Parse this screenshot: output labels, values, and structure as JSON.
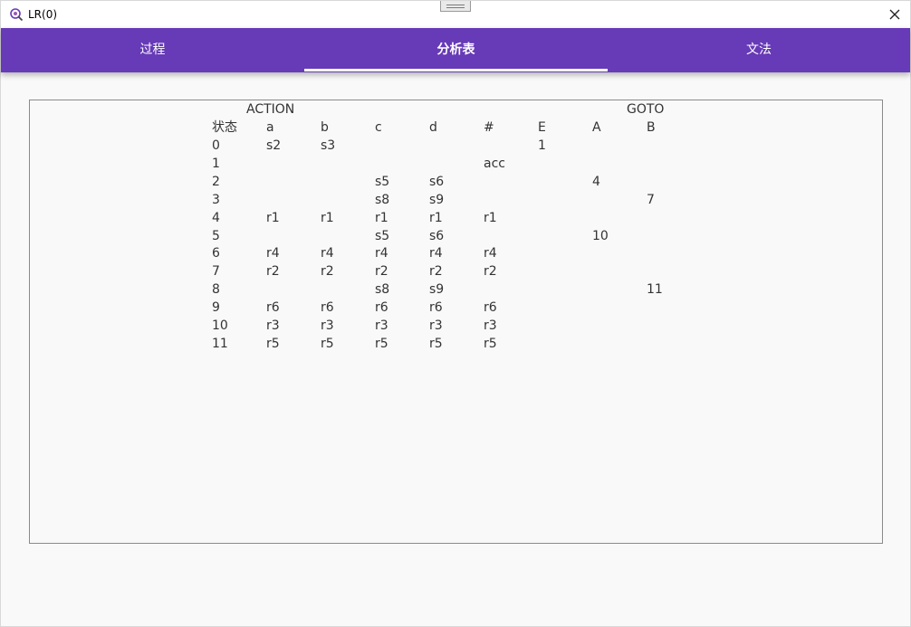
{
  "window": {
    "title": "LR(0)"
  },
  "tabs": [
    {
      "label": "过程"
    },
    {
      "label": "分析表"
    },
    {
      "label": "文法"
    }
  ],
  "active_tab_index": 1,
  "colors": {
    "tabbar": "#673ab7",
    "tab_text": "#ffffff",
    "table_text": "#333333"
  },
  "table": {
    "action_header": "ACTION",
    "goto_header": "GOTO",
    "columns": [
      "状态",
      "a",
      "b",
      "c",
      "d",
      "#",
      "E",
      "A",
      "B"
    ],
    "rows": [
      [
        "0",
        "s2",
        "s3",
        "",
        "",
        "",
        "1",
        "",
        ""
      ],
      [
        "1",
        "",
        "",
        "",
        "",
        "acc",
        "",
        "",
        ""
      ],
      [
        "2",
        "",
        "",
        "s5",
        "s6",
        "",
        "",
        "4",
        ""
      ],
      [
        "3",
        "",
        "",
        "s8",
        "s9",
        "",
        "",
        "",
        "7"
      ],
      [
        "4",
        "r1",
        "r1",
        "r1",
        "r1",
        "r1",
        "",
        "",
        ""
      ],
      [
        "5",
        "",
        "",
        "s5",
        "s6",
        "",
        "",
        "10",
        ""
      ],
      [
        "6",
        "r4",
        "r4",
        "r4",
        "r4",
        "r4",
        "",
        "",
        ""
      ],
      [
        "7",
        "r2",
        "r2",
        "r2",
        "r2",
        "r2",
        "",
        "",
        ""
      ],
      [
        "8",
        "",
        "",
        "s8",
        "s9",
        "",
        "",
        "",
        "11"
      ],
      [
        "9",
        "r6",
        "r6",
        "r6",
        "r6",
        "r6",
        "",
        "",
        ""
      ],
      [
        "10",
        "r3",
        "r3",
        "r3",
        "r3",
        "r3",
        "",
        "",
        ""
      ],
      [
        "11",
        "r5",
        "r5",
        "r5",
        "r5",
        "r5",
        "",
        "",
        ""
      ]
    ]
  }
}
